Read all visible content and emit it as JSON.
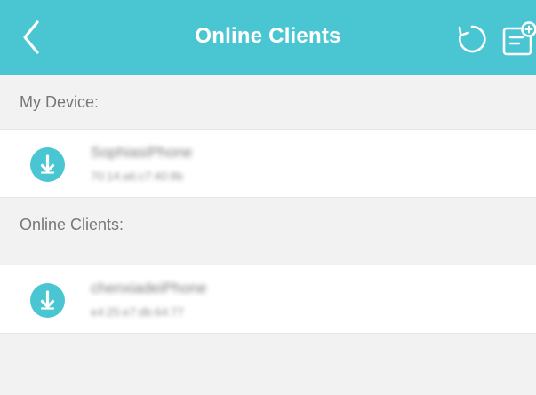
{
  "header": {
    "title": "Online Clients",
    "back_icon": "chevron-left-icon",
    "refresh_icon": "refresh-icon",
    "edit_icon": "edit-icon",
    "background_color": "#4ac6d3",
    "text_color": "#ffffff"
  },
  "sections": {
    "my_device": {
      "label": "My Device:",
      "clients": [
        {
          "name": "SophiasiPhone",
          "mac": "70:14:a6:c7:40:8b",
          "icon": "download-icon"
        }
      ]
    },
    "online_clients": {
      "label": "Online Clients:",
      "clients": [
        {
          "name": "chenxiadeiPhone",
          "mac": "e4:25:e7:db:64:77",
          "icon": "download-icon"
        }
      ]
    }
  },
  "colors": {
    "accent": "#4ac6d3",
    "page_background": "#f2f2f2",
    "row_background": "#ffffff",
    "muted_text": "#777777"
  }
}
